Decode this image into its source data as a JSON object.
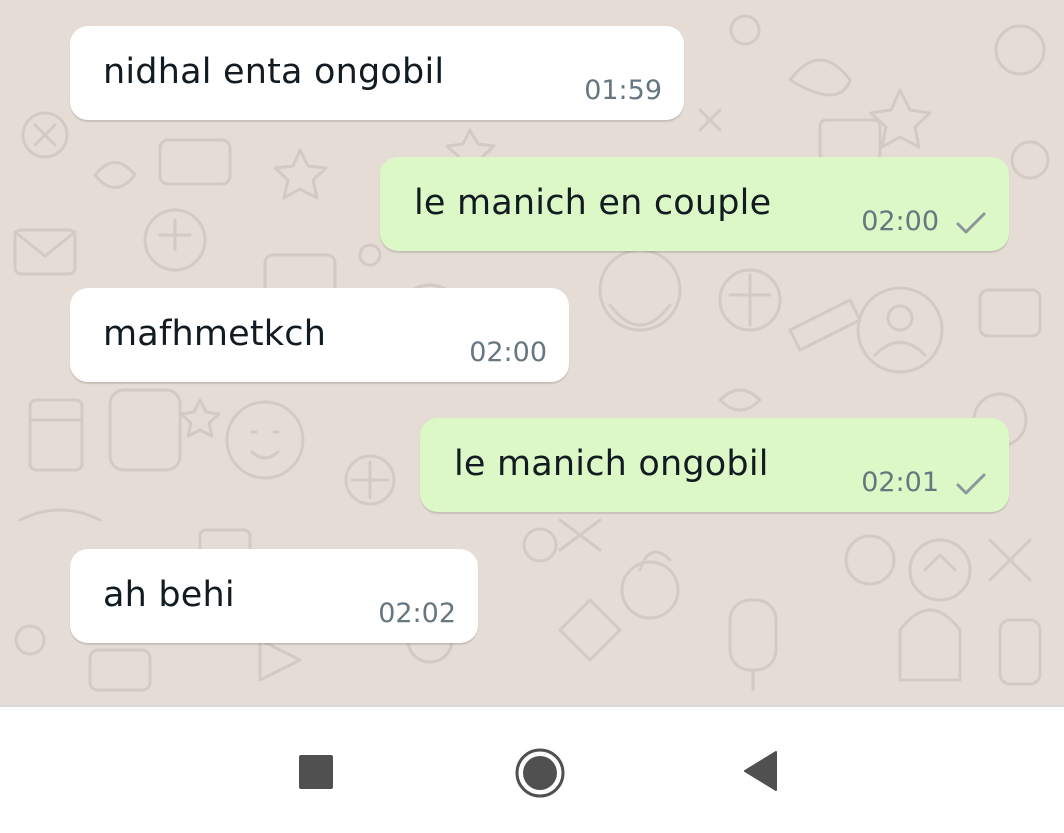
{
  "theme": {
    "chat_background": "#e5ddd5",
    "incoming_bubble": "#ffffff",
    "outgoing_bubble": "#dcf8c6",
    "timestamp_color": "#667781",
    "nav_icon_color": "#505050"
  },
  "messages": [
    {
      "direction": "incoming",
      "text": "nidhal enta ongobil",
      "time": "01:59"
    },
    {
      "direction": "outgoing",
      "text": "le manich en couple",
      "time": "02:00",
      "status": "sent"
    },
    {
      "direction": "incoming",
      "text": "mafhmetkch",
      "time": "02:00"
    },
    {
      "direction": "outgoing",
      "text": "le manich ongobil",
      "time": "02:01",
      "status": "sent"
    },
    {
      "direction": "incoming",
      "text": "ah behi",
      "time": "02:02"
    }
  ],
  "nav_bar": {
    "buttons": [
      {
        "name": "recents",
        "icon": "square-icon"
      },
      {
        "name": "home",
        "icon": "circle-icon"
      },
      {
        "name": "back",
        "icon": "triangle-back-icon"
      }
    ]
  }
}
